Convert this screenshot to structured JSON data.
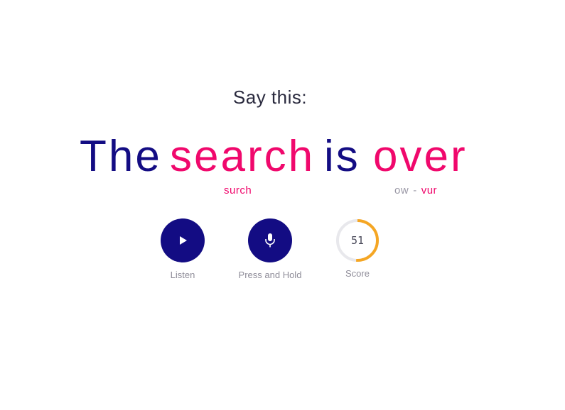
{
  "prompt": {
    "label": "Say this:"
  },
  "sentence": {
    "words": [
      "The",
      "search",
      "is",
      "over"
    ],
    "highlight_color": "#f0086c",
    "base_color": "#130c83"
  },
  "pronunciations": {
    "search": "surch",
    "over": {
      "weak": "ow",
      "separator": "-",
      "strong": "vur"
    }
  },
  "controls": {
    "listen": {
      "label": "Listen",
      "icon": "play-icon"
    },
    "record": {
      "label": "Press and Hold",
      "icon": "microphone-icon"
    },
    "score": {
      "label": "Score",
      "value": "51",
      "progress": 0.51,
      "color": "#f5a623"
    }
  }
}
